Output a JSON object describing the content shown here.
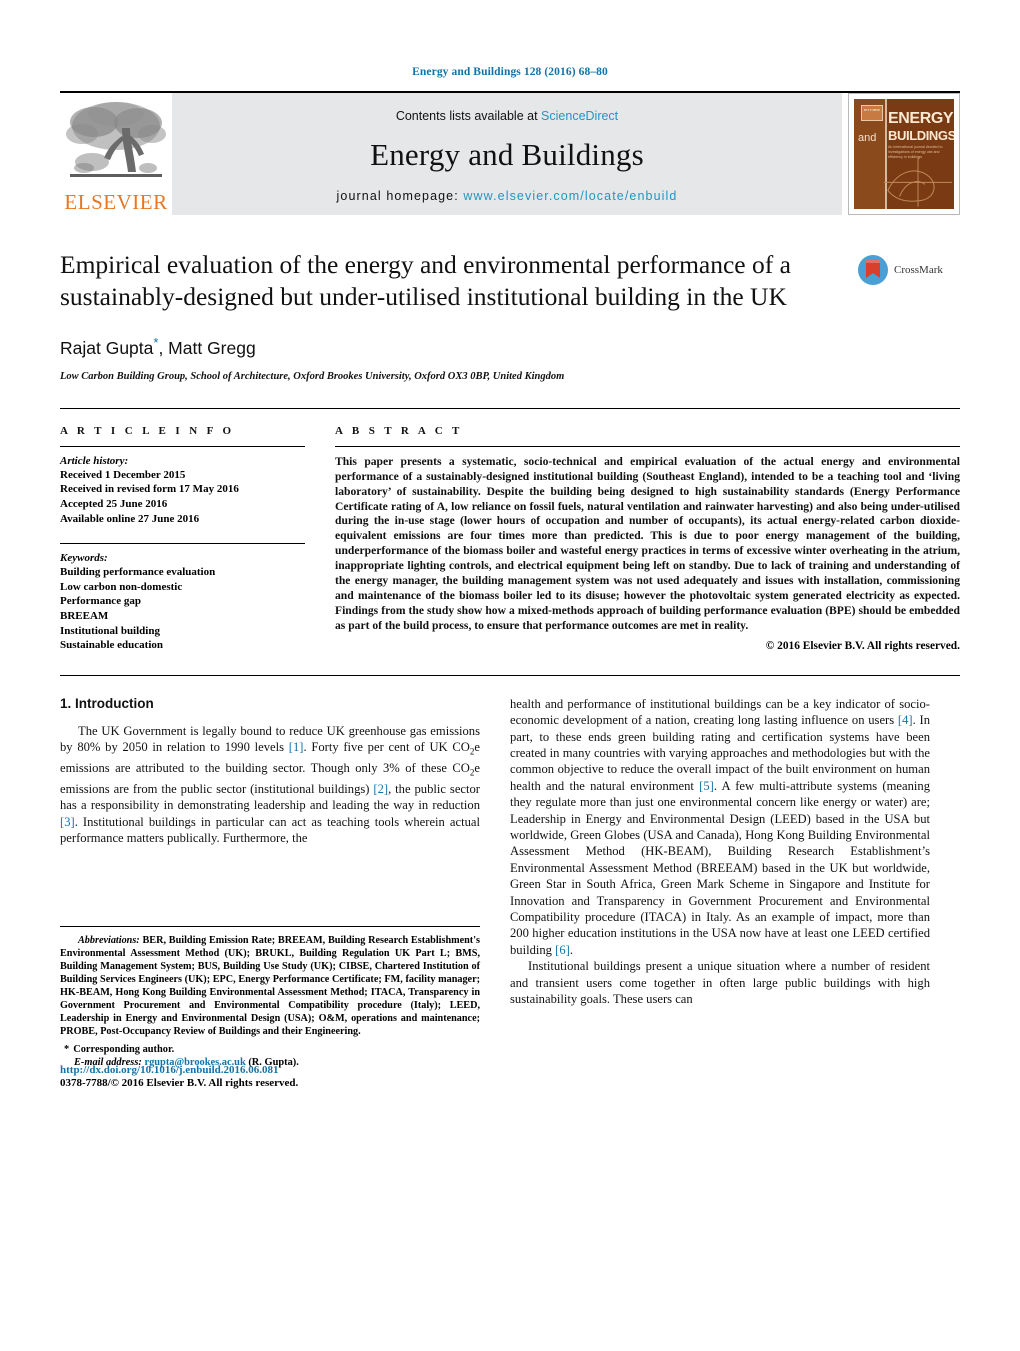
{
  "running_head": "Energy and Buildings 128 (2016) 68–80",
  "masthead": {
    "publisher_name": "ELSEVIER",
    "contents_prefix": "Contents lists available at",
    "contents_link": "ScienceDirect",
    "journal_title": "Energy and Buildings",
    "homepage_prefix": "journal homepage:",
    "homepage_url": "www.elsevier.com/locate/enbuild",
    "cover": {
      "and_word": "and",
      "energy_word": "ENERGY",
      "buildings_word": "BUILDINGS",
      "subtitle": "An international journal devoted to investigations of energy use and efficiency in buildings",
      "badge": "IET CIBSE"
    }
  },
  "article": {
    "title": "Empirical evaluation of the energy and environmental performance of a sustainably-designed but under-utilised institutional building in the UK",
    "crossmark_label": "CrossMark",
    "authors": "Rajat Gupta",
    "authors_rest": ", Matt Gregg",
    "corresponding_star": "*",
    "affiliation": "Low Carbon Building Group, School of Architecture, Oxford Brookes University, Oxford OX3 0BP, United Kingdom"
  },
  "article_info": {
    "heading": "A R T I C L E    I N F O",
    "history_label": "Article history:",
    "history": [
      "Received 1 December 2015",
      "Received in revised form 17 May 2016",
      "Accepted 25 June 2016",
      "Available online 27 June 2016"
    ],
    "keywords_label": "Keywords:",
    "keywords": [
      "Building performance evaluation",
      "Low carbon non-domestic",
      "Performance gap",
      "BREEAM",
      "Institutional building",
      "Sustainable education"
    ]
  },
  "abstract": {
    "heading": "A B S T R A C T",
    "text": "This paper presents a systematic, socio-technical and empirical evaluation of the actual energy and environmental performance of a sustainably-designed institutional building (Southeast England), intended to be a teaching tool and ‘living laboratory’ of sustainability. Despite the building being designed to high sustainability standards (Energy Performance Certificate rating of A, low reliance on fossil fuels, natural ventilation and rainwater harvesting) and also being under-utilised during the in-use stage (lower hours of occupation and number of occupants), its actual energy-related carbon dioxide-equivalent emissions are four times more than predicted. This is due to poor energy management of the building, underperformance of the biomass boiler and wasteful energy practices in terms of excessive winter overheating in the atrium, inappropriate lighting controls, and electrical equipment being left on standby. Due to lack of training and understanding of the energy manager, the building management system was not used adequately and issues with installation, commissioning and maintenance of the biomass boiler led to its disuse; however the photovoltaic system generated electricity as expected. Findings from the study show how a mixed-methods approach of building performance evaluation (BPE) should be embedded as part of the build process, to ensure that performance outcomes are met in reality.",
    "copyright": "© 2016 Elsevier B.V. All rights reserved."
  },
  "introduction": {
    "heading": "1.  Introduction",
    "left_p1_a": "The UK Government is legally bound to reduce UK greenhouse gas emissions by 80% by 2050 in relation to 1990 levels ",
    "ref1": "[1]",
    "left_p1_b": ". Forty five per cent of UK CO",
    "sub2_a": "2",
    "left_p1_c": "e emissions are attributed to the building sector. Though only 3% of these CO",
    "sub2_b": "2",
    "left_p1_d": "e emissions are from the public sector (institutional buildings) ",
    "ref2": "[2]",
    "left_p1_e": ", the public sector has a responsibility in demonstrating leadership and leading the way in reduction ",
    "ref3": "[3]",
    "left_p1_f": ". Institutional buildings in particular can act as teaching tools wherein actual performance matters publically. Furthermore, the",
    "right_p1_a": "health and performance of institutional buildings can be a key indicator of socio-economic development of a nation, creating long lasting influence on users ",
    "ref4": "[4]",
    "right_p1_b": ". In part, to these ends green building rating and certification systems have been created in many countries with varying approaches and methodologies but with the common objective to reduce the overall impact of the built environment on human health and the natural environment ",
    "ref5": "[5]",
    "right_p1_c": ". A few multi-attribute systems (meaning they regulate more than just one environmental concern like energy or water) are; Leadership in Energy and Environmental Design (LEED) based in the USA but worldwide, Green Globes (USA and Canada), Hong Kong Building Environmental Assessment Method (HK-BEAM), Building Research Establishment’s Environmental Assessment Method (BREEAM) based in the UK but worldwide, Green Star in South Africa, Green Mark Scheme in Singapore and Institute for Innovation and Transparency in Government Procurement and Environmental Compatibility procedure (ITACA) in Italy. As an example of impact, more than 200 higher education institutions in the USA now have at least one LEED certified building ",
    "ref6": "[6]",
    "right_p1_d": ".",
    "right_p2": "Institutional buildings present a unique situation where a number of resident and transient users come together in often large public buildings with high sustainability goals. These users can"
  },
  "footnote": {
    "abbrev_label": "Abbreviations:",
    "abbrev_text": " BER, Building Emission Rate; BREEAM, Building Research Establishment's Environmental Assessment Method (UK); BRUKL, Building Regulation UK Part L; BMS, Building Management System; BUS, Building Use Study (UK); CIBSE, Chartered Institution of Building Services Engineers (UK); EPC, Energy Performance Certificate; FM, facility manager; HK-BEAM, Hong Kong Building Environmental Assessment Method; ITACA, Transparency in Government Procurement and Environmental Compatibility procedure (Italy); LEED, Leadership in Energy and Environmental Design (USA); O&M, operations and maintenance; PROBE, Post-Occupancy Review of Buildings and their Engineering.",
    "corresponding_star": "*",
    "corresponding_text": "Corresponding author.",
    "email_label": "E-mail address:",
    "email": "rgupta@brookes.ac.uk",
    "email_owner": "(R. Gupta)."
  },
  "doi_footer": {
    "doi_url": "http://dx.doi.org/10.1016/j.enbuild.2016.06.081",
    "issn_line": "0378-7788/© 2016 Elsevier B.V. All rights reserved."
  },
  "colors": {
    "link_blue": "#1273a8",
    "elsevier_orange": "#e87722",
    "band_grey": "#e6e7e9",
    "cover_brown": "#7a3b14"
  }
}
